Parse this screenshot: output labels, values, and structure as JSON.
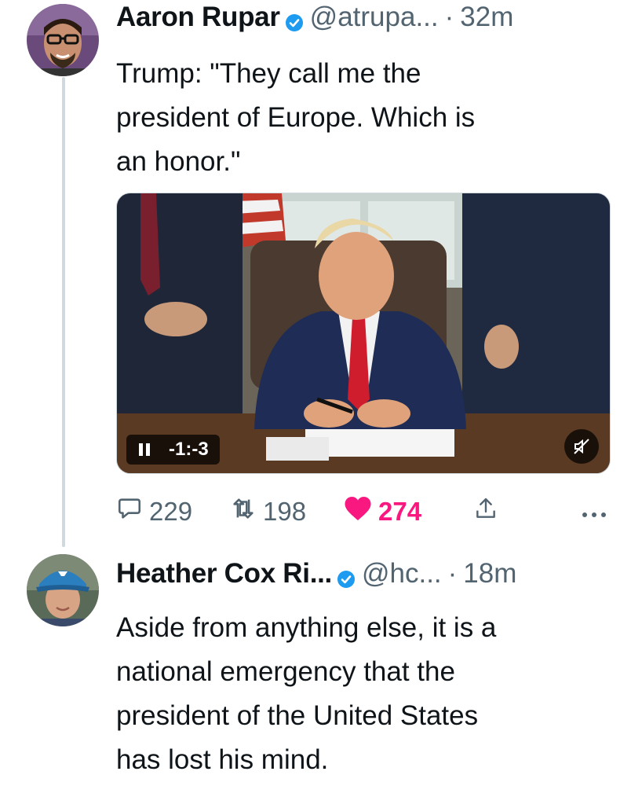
{
  "tweets": [
    {
      "author_name": "Aaron Rupar",
      "handle": "@atrupa...",
      "separator": "·",
      "time": "32m",
      "text": "Trump: \"They call me the\npresident of Europe. Which is\nan honor.\"",
      "video": {
        "time_remaining": "-1:-3"
      },
      "stats": {
        "replies": "229",
        "retweets": "198",
        "likes": "274"
      }
    },
    {
      "author_name": "Heather Cox Ri...",
      "handle": "@hc...",
      "separator": "·",
      "time": "18m",
      "text": "Aside from anything else, it is a\nnational emergency that the\npresident of the United States\nhas lost his mind."
    }
  ],
  "colors": {
    "verified": "#1d9bf0",
    "like": "#f91880",
    "secondary_text": "#536471",
    "thread_line": "#cfd9de"
  },
  "icons": {
    "verified": "verified-badge-icon",
    "reply": "reply-icon",
    "retweet": "retweet-icon",
    "like": "heart-icon",
    "share": "share-icon",
    "more": "more-icon",
    "pause": "pause-icon",
    "mute": "mute-icon"
  }
}
